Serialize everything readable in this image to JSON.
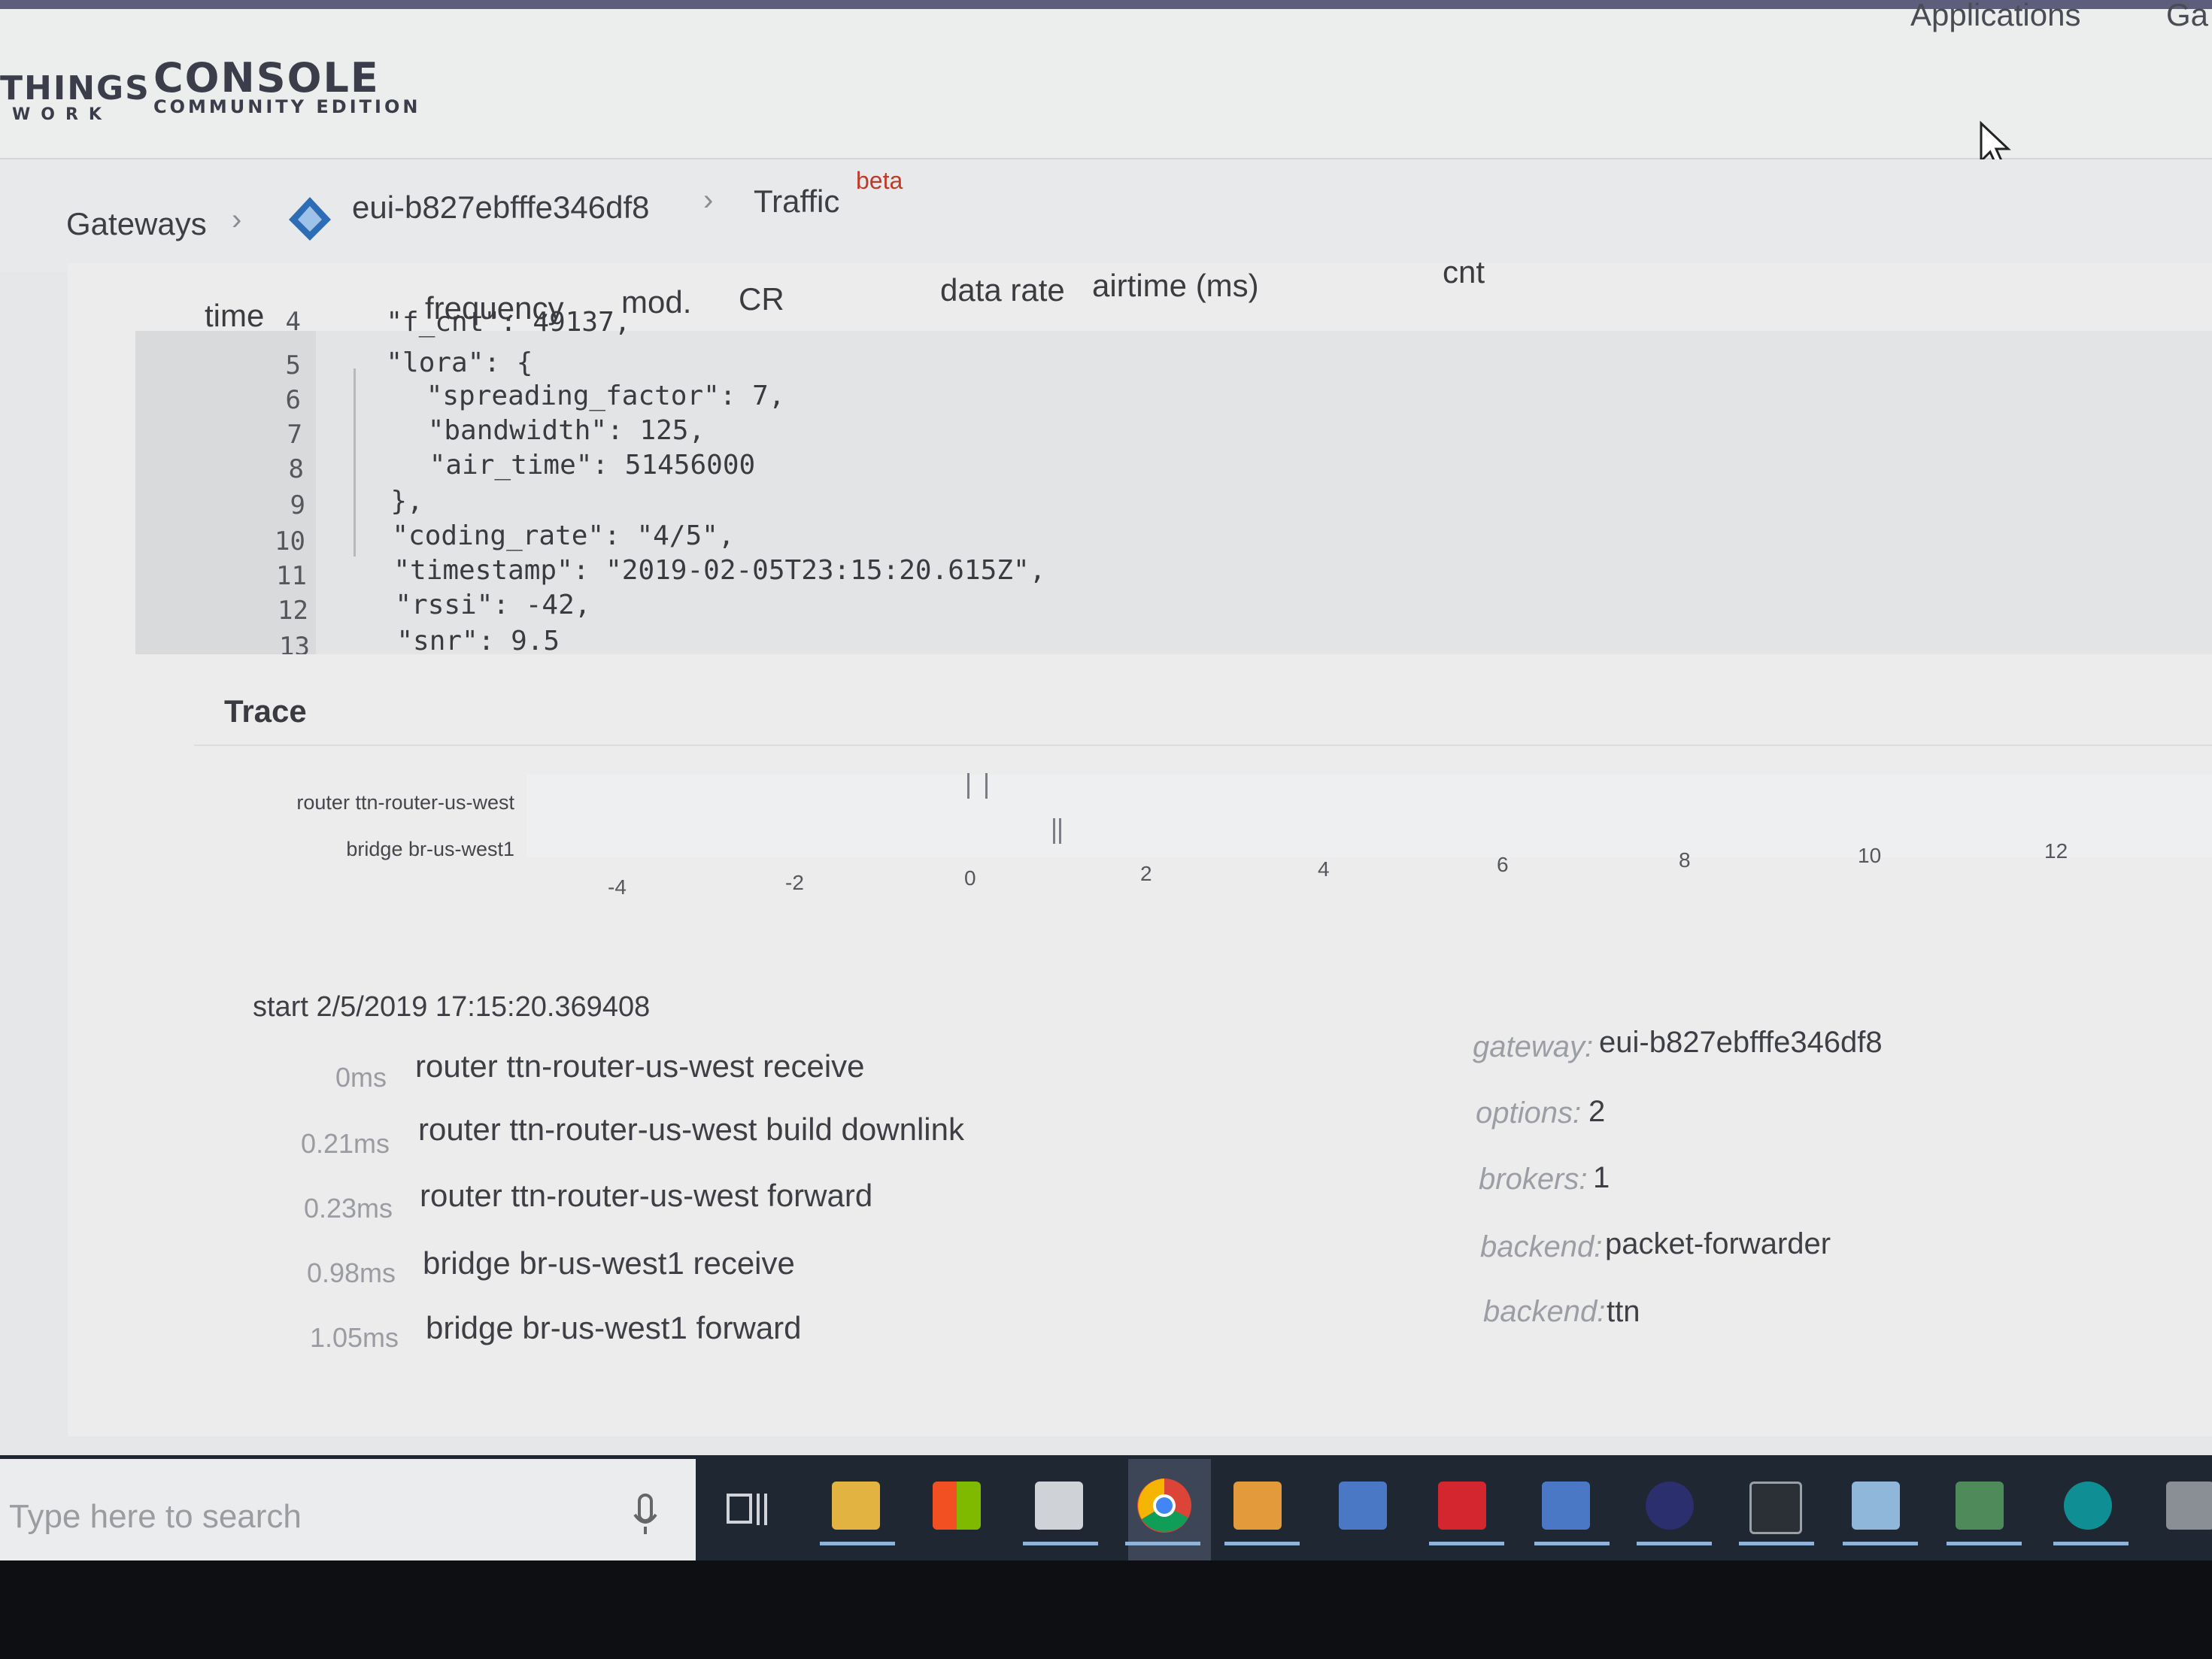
{
  "header": {
    "brand_top": "THINGS",
    "brand_bottom": "WORK",
    "console_title": "CONSOLE",
    "console_subtitle": "COMMUNITY EDITION",
    "nav_applications": "Applications",
    "nav_gateways_partial": "Ga"
  },
  "breadcrumb": {
    "gateways": "Gateways",
    "gateway_id": "eui-b827ebfffe346df8",
    "traffic": "Traffic",
    "beta": "beta"
  },
  "columns": {
    "time": "time",
    "frequency": "frequency",
    "mod": "mod.",
    "cr": "CR",
    "data_rate": "data rate",
    "airtime": "airtime (ms)",
    "cnt": "cnt"
  },
  "code": {
    "lines": [
      {
        "no": "4",
        "text": "  \"f_cnt\": 49137,"
      },
      {
        "no": "5",
        "text": "  \"lora\": {"
      },
      {
        "no": "6",
        "text": "    \"spreading_factor\": 7,"
      },
      {
        "no": "7",
        "text": "    \"bandwidth\": 125,"
      },
      {
        "no": "8",
        "text": "    \"air_time\": 51456000"
      },
      {
        "no": "9",
        "text": "  },"
      },
      {
        "no": "10",
        "text": "  \"coding_rate\": \"4/5\","
      },
      {
        "no": "11",
        "text": "  \"timestamp\": \"2019-02-05T23:15:20.615Z\","
      },
      {
        "no": "12",
        "text": "  \"rssi\": -42,"
      },
      {
        "no": "13",
        "text": "  \"snr\": 9.5"
      }
    ]
  },
  "trace": {
    "title": "Trace",
    "rows": [
      "router ttn-router-us-west",
      "bridge br-us-west1"
    ],
    "ticks": [
      "-4",
      "-2",
      "0",
      "2",
      "4",
      "6",
      "8",
      "10",
      "12"
    ],
    "start": "start 2/5/2019 17:15:20.369408",
    "steps": [
      {
        "time": "0ms",
        "text": "router ttn-router-us-west receive"
      },
      {
        "time": "0.21ms",
        "text": "router ttn-router-us-west build downlink"
      },
      {
        "time": "0.23ms",
        "text": "router ttn-router-us-west forward"
      },
      {
        "time": "0.98ms",
        "text": "bridge br-us-west1 receive"
      },
      {
        "time": "1.05ms",
        "text": "bridge br-us-west1 forward"
      }
    ],
    "meta": [
      {
        "key": "gateway:",
        "value": "eui-b827ebfffe346df8"
      },
      {
        "key": "options:",
        "value": "2"
      },
      {
        "key": "brokers:",
        "value": "1"
      },
      {
        "key": "backend:",
        "value": "packet-forwarder"
      },
      {
        "key": "backend:",
        "value": "ttn"
      }
    ]
  },
  "taskbar": {
    "search_placeholder": "Type here to search"
  },
  "colors": {
    "accent_blue": "#2d6db5",
    "beta_red": "#c0392b",
    "taskbar": "#1f2733"
  }
}
